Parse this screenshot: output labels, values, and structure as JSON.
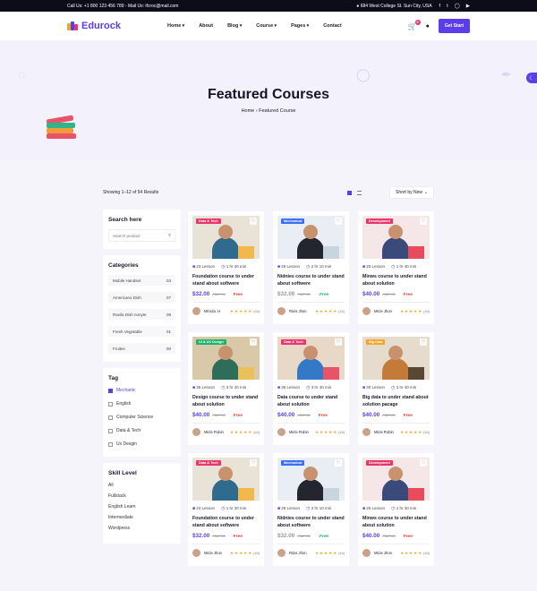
{
  "topbar": {
    "contact": "Call Us: +1 800 123 456 789 - Mail Us: ifcroc@mail.com",
    "address": "684 West College St. Sun City, USA"
  },
  "header": {
    "logo": "Edurock",
    "nav": [
      "Home",
      "About",
      "Blog",
      "Course",
      "Pages",
      "Contact"
    ],
    "cart_count": "0",
    "cta": "Get Start"
  },
  "hero": {
    "title": "Featured Courses",
    "crumb_home": "Home",
    "crumb_current": "Featured Course"
  },
  "toolbar": {
    "results": "Showing 1–12 of 54 Results",
    "sort": "Short by New"
  },
  "sidebar": {
    "search_title": "Search here",
    "search_placeholder": "Search product",
    "categories_title": "Categories",
    "categories": [
      {
        "name": "Mobile Handset",
        "count": "03"
      },
      {
        "name": "Americano Dish",
        "count": "07"
      },
      {
        "name": "Raxila Dish nonyte",
        "count": "09"
      },
      {
        "name": "Fresh Vegetable",
        "count": "01"
      },
      {
        "name": "Fruites",
        "count": "00"
      }
    ],
    "tag_title": "Tag",
    "tags": [
      "Mechanic",
      "English",
      "Computer Science",
      "Data & Tech",
      "Ux Desgin"
    ],
    "level_title": "Skill Level",
    "levels": [
      "All",
      "Fullstack",
      "English Learn",
      "Intermediate",
      "Wordpress"
    ]
  },
  "courses": [
    {
      "badge": "Data & Tech",
      "badge_color": "#e8366d",
      "lessons": "23 Lesson",
      "duration": "1 hr 30 min",
      "title": "Foundation course to under stand about softwere",
      "price": "$32.00",
      "old": "/ $67.00",
      "free": "Free",
      "author": "Mirnda .H",
      "reviews": "(44)"
    },
    {
      "badge": "Mechanical",
      "badge_color": "#3b6ef0",
      "lessons": "29 Lesson",
      "duration": "2 hr 10 min",
      "title": "Nidnies course to under stand about softwere",
      "price": "$32.00",
      "old": "/ $67.00",
      "free": ".Free",
      "author": "Rinis Jhon",
      "reviews": "(44)"
    },
    {
      "badge": "Development",
      "badge_color": "#e8366d",
      "lessons": "25 Lesson",
      "duration": "1 hr 40 min",
      "title": "Minws course to under stand about solution",
      "price": "$40.00",
      "old": "/ $67.00",
      "free": "Free",
      "author": "Micle Jhon",
      "reviews": "(44)"
    },
    {
      "badge": "UI & UX Design",
      "badge_color": "#1db46b",
      "lessons": "36 Lesson",
      "duration": "3 hr 40 min",
      "title": "Design course to under stand about solution",
      "price": "$40.00",
      "old": "/ $67.00",
      "free": "Free",
      "author": "Micle Robin",
      "reviews": "(44)"
    },
    {
      "badge": "Data & Tech",
      "badge_color": "#e8366d",
      "lessons": "36 Lesson",
      "duration": "3 hr 40 min",
      "title": "Data course to under stand about solution",
      "price": "$40.00",
      "old": "/ $67.00",
      "free": "Free",
      "author": "Micle Robin",
      "reviews": "(44)"
    },
    {
      "badge": "Big Data",
      "badge_color": "#f4a427",
      "lessons": "30 Lesson",
      "duration": "3 hr 40 min",
      "title": "Big data to under stand about solution pacage",
      "price": "$40.00",
      "old": "/ $67.00",
      "free": "Free",
      "author": "Micle Robin",
      "reviews": "(44)"
    },
    {
      "badge": "Data & Tech",
      "badge_color": "#e8366d",
      "lessons": "23 Lesson",
      "duration": "1 hr 30 min",
      "title": "Foundation course to under stand about softwere",
      "price": "$32.00",
      "old": "/ $67.00",
      "free": "Free",
      "author": "Micle Jhon",
      "reviews": "(44)"
    },
    {
      "badge": "Mechanical",
      "badge_color": "#3b6ef0",
      "lessons": "29 Lesson",
      "duration": "2 hr 10 min",
      "title": "Nidnies course to under stand about softwere",
      "price": "$32.00",
      "old": "/ $67.00",
      "free": ".Free",
      "author": "Rinis Jhon",
      "reviews": "(44)"
    },
    {
      "badge": "Development",
      "badge_color": "#e8366d",
      "lessons": "25 Lesson",
      "duration": "1 hr 40 min",
      "title": "Minws course to under stand about solution",
      "price": "$40.00",
      "old": "/ $67.00",
      "free": "Free",
      "author": "Micle Jhon",
      "reviews": "(44)"
    }
  ],
  "colors": {
    "accent": "#5b3ee8",
    "free_red": "#e83a3a",
    "free_green": "#1db46b",
    "star": "#f4a427"
  }
}
